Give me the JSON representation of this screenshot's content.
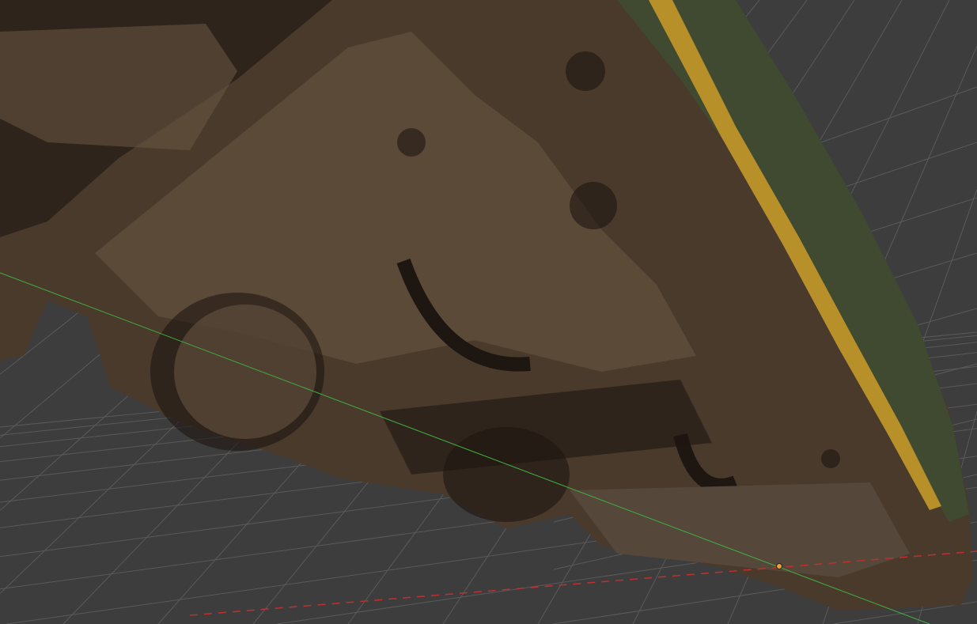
{
  "viewport": {
    "background_color": "#3d3d3d",
    "grid_color": "#5a5a5a",
    "x_axis_color": "#c03030",
    "y_axis_color": "#3fae3f",
    "origin_color": "#f0a030"
  },
  "model": {
    "base_color": "#4a3a2c",
    "shadow_color": "#1e1610",
    "highlight_color": "#6b5846",
    "stripe_color": "#b8902a",
    "side_color": "#3f4a30"
  }
}
